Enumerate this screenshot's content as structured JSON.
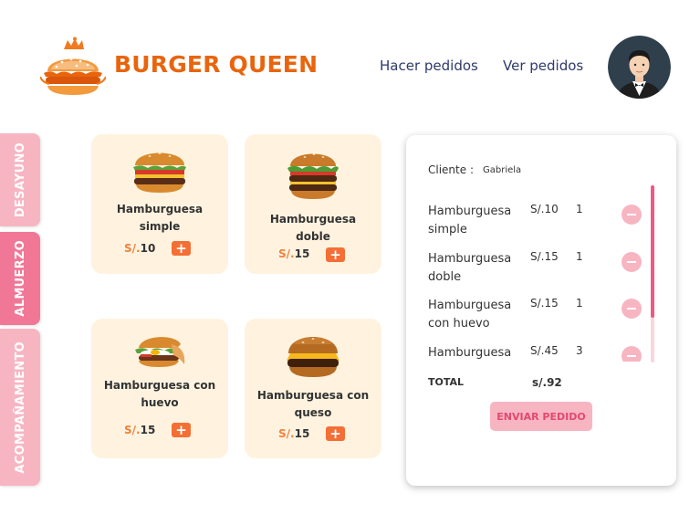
{
  "header": {
    "brand": "BURGER QUEEN",
    "nav": [
      "Hacer pedidos",
      "Ver pedidos"
    ]
  },
  "categories": [
    "DESAYUNO",
    "ALMUERZO",
    "ACOMPAÑAMIENTO"
  ],
  "active_category": "ALMUERZO",
  "products": [
    {
      "name": "Hamburguesa simple",
      "currency": "S/.",
      "price": "10"
    },
    {
      "name": "Hamburguesa doble",
      "currency": "S/.",
      "price": "15"
    },
    {
      "name": "Hamburguesa con huevo",
      "currency": "S/.",
      "price": "15"
    },
    {
      "name": "Hamburguesa con queso",
      "currency": "S/.",
      "price": "15"
    }
  ],
  "order": {
    "client_label": "Cliente :",
    "client_name": "Gabriela",
    "items": [
      {
        "name": "Hamburguesa simple",
        "price": "S/.10",
        "qty": "1"
      },
      {
        "name": "Hamburguesa doble",
        "price": "S/.15",
        "qty": "1"
      },
      {
        "name": "Hamburguesa con huevo",
        "price": "S/.15",
        "qty": "1"
      },
      {
        "name": "Hamburguesa con queso",
        "price": "S/.45",
        "qty": "3"
      }
    ],
    "total_label": "TOTAL",
    "total_value": "s/.92",
    "send_label": "ENVIAR PEDIDO"
  },
  "colors": {
    "brand": "#E8650E",
    "nav": "#2E3A6B",
    "tab_active": "#F07896",
    "tab_inactive": "#F7B5C2",
    "card_bg": "#FFF3E0",
    "add_button": "#F46F35",
    "send_text": "#E2496F"
  },
  "icons": {
    "logo": "burger-crown-logo",
    "avatar": "waiter-avatar",
    "add": "plus-icon",
    "remove": "minus-icon"
  }
}
